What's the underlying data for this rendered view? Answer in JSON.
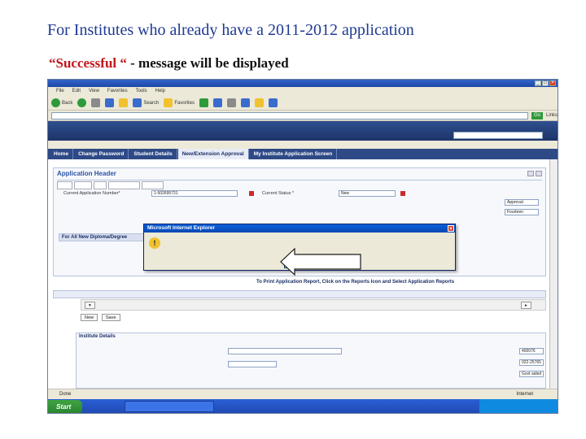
{
  "slide": {
    "title": "For Institutes who already have a 2011-2012  application",
    "caption_highlight": "“Successful “",
    "caption_rest": " - message will be displayed"
  },
  "browser": {
    "menu": [
      "File",
      "Edit",
      "View",
      "Favorites",
      "Tools",
      "Help"
    ],
    "toolbar": {
      "back": "Back",
      "search": "Search",
      "favorites": "Favorites"
    },
    "go_label": "Go",
    "links_label": "Links"
  },
  "nav_tabs": [
    "Home",
    "Change Password",
    "Student Details",
    "New/Extension Approval",
    "My Institute Application Screen"
  ],
  "app": {
    "header_title": "Application Header",
    "fields": {
      "current_app_number_label": "Current Application Number*",
      "current_app_number_value": "1-502695731",
      "current_status_label": "Current Status *",
      "current_status_value": "New"
    },
    "section_for_all_new": "For All New Diploma/Degree",
    "print_note": "To Print Application Report, Click on the Reports Icon and Select Application Reports",
    "inst_details_title": "Institute Details",
    "buttons": {
      "new": "New",
      "save": "Save"
    },
    "side_values": {
      "approval": "Approval",
      "fourteen": "Fourteen",
      "pincode": "400076",
      "phone": "022-25765",
      "gov_aided": "Govt aided"
    }
  },
  "dialog": {
    "title": "Microsoft Internet Explorer",
    "ok_label": "OK"
  },
  "status": {
    "done": "Done",
    "zone": "Internet",
    "start": "Start"
  }
}
